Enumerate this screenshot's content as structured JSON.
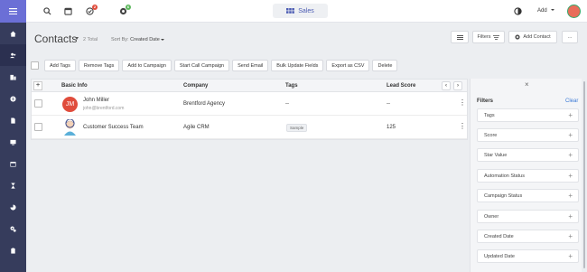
{
  "sidebar": {
    "items": [
      {
        "icon": "home-icon"
      },
      {
        "icon": "contacts-icon"
      },
      {
        "icon": "companies-icon"
      },
      {
        "icon": "deals-icon"
      },
      {
        "icon": "documents-icon"
      },
      {
        "icon": "inbox-icon"
      },
      {
        "icon": "calendar-icon"
      },
      {
        "icon": "hourglass-icon"
      },
      {
        "icon": "reports-icon"
      },
      {
        "icon": "settings-icon"
      },
      {
        "icon": "clipboard-icon"
      }
    ]
  },
  "topbar": {
    "title": "Sales",
    "badges": {
      "tasks": "2",
      "activity": "6"
    },
    "add_label": "Add"
  },
  "header": {
    "title": "Contacts",
    "total": "2 Total",
    "sort_prefix": "Sort By:",
    "sort_value": "Created Date",
    "filters_label": "Filters",
    "add_contact_label": "Add Contact",
    "more_label": "..."
  },
  "toolbar": {
    "buttons": [
      "Add Tags",
      "Remove Tags",
      "Add to Campaign",
      "Start Call Campaign",
      "Send Email",
      "Bulk Update Fields",
      "Export as CSV",
      "Delete"
    ]
  },
  "table": {
    "columns": [
      "Basic Info",
      "Company",
      "Tags",
      "Lead Score"
    ],
    "rows": [
      {
        "initials": "JM",
        "name": "John Miller",
        "email": "john@brentford.com",
        "company": "Brentford Agency",
        "tags": "--",
        "score": "--"
      },
      {
        "initials": "",
        "name": "Customer Success Team",
        "email": "",
        "company": "Agile CRM",
        "tags": "Sample",
        "score": "125"
      }
    ]
  },
  "filters": {
    "title": "Filters",
    "clear": "Clear",
    "close": "×",
    "items": [
      "Tags",
      "Score",
      "Star Value",
      "Automation Status",
      "Campaign Status",
      "Owner",
      "Created Date",
      "Updated Date"
    ]
  },
  "colors": {
    "sidebar": "#363c5c",
    "sidebar_top": "#6b6fd6",
    "accent": "#4b5bb3",
    "clear_link": "#3a79d6",
    "avatar_jm": "#e04c3c"
  }
}
